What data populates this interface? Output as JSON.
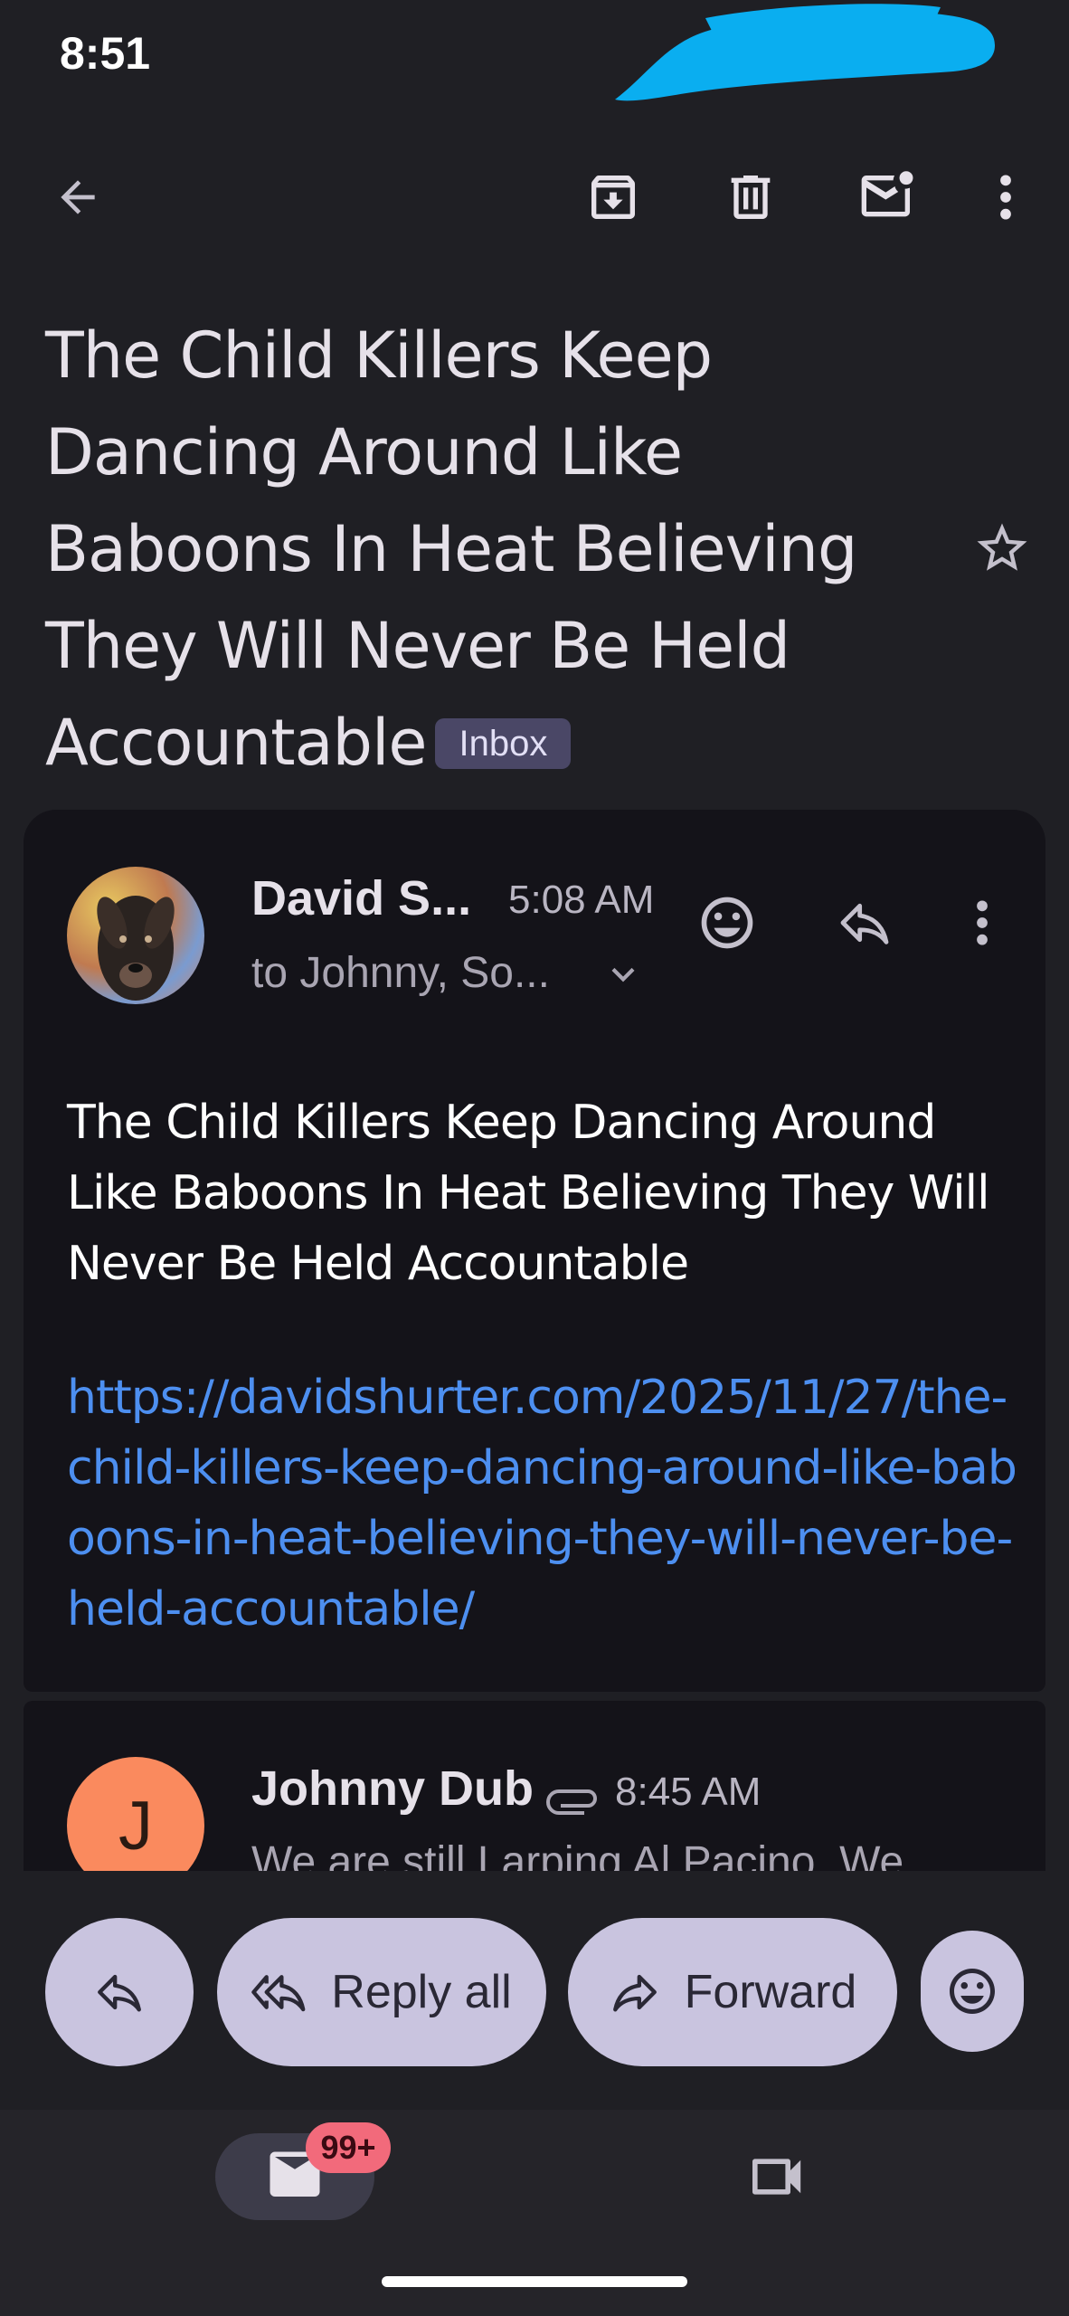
{
  "status_bar": {
    "time": "8:51"
  },
  "top_bar": {
    "icons": [
      "arrow-back-icon",
      "archive-icon",
      "delete-icon",
      "mark-unread-icon",
      "more-vert-icon"
    ]
  },
  "subject": {
    "text": "The Child Killers Keep Dancing Around Like Baboons In Heat Believing They Will Never Be Held Accountable",
    "label_chip": "Inbox",
    "starred": false
  },
  "message": {
    "sender": "David S...",
    "time": "5:08 AM",
    "recipients": "to Johnny, So...",
    "body": "The Child Killers Keep Dancing Around Like Baboons In Heat Believing They Will Never Be Held Accountable",
    "link": "https://davidshurter.com/2025/11/27/the-child-killers-keep-dancing-around-like-baboons-in-heat-believing-they-will-never-be-held-accountable/"
  },
  "next_message": {
    "avatar_letter": "J",
    "sender": "Johnny Dub",
    "time": "8:45 AM",
    "snippet": "We are still Larping Al Pacino. We"
  },
  "actions": {
    "reply_all": "Reply all",
    "forward": "Forward"
  },
  "bottom_nav": {
    "mail_badge": "99+"
  },
  "colors": {
    "background": "#1f1f24",
    "card": "#141319",
    "pill": "#c9c4df",
    "link": "#4d8ff0",
    "avatar_j": "#fa8a5e",
    "badge": "#f26a7b",
    "chip": "#4a4766"
  }
}
